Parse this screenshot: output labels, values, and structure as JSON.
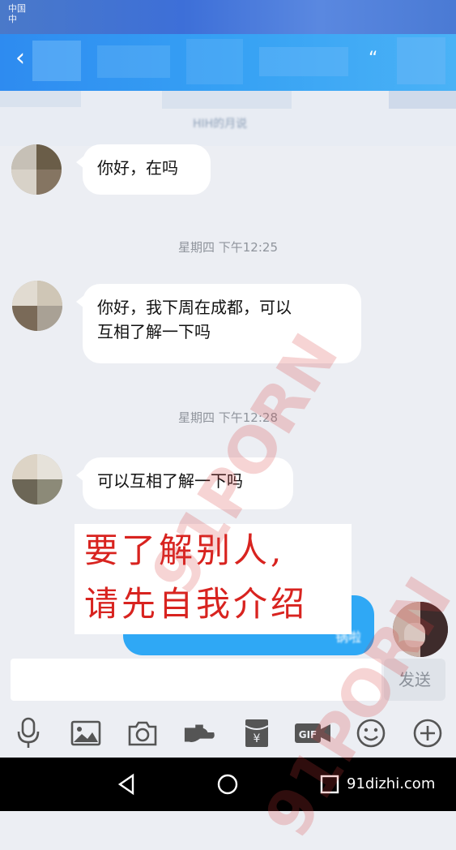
{
  "status_bar": {
    "carrier_line1": "中国",
    "carrier_line2": "中"
  },
  "header": {
    "back_icon": "back-arrow-icon",
    "subtitle_blurred": "HIH的月说"
  },
  "messages": [
    {
      "from": "other",
      "text": "你好，在吗"
    },
    {
      "type": "timestamp",
      "text": "星期四 下午12:25"
    },
    {
      "from": "other",
      "text_line1": "你好，我下周在成都，可以",
      "text_line2": "互相了解一下吗"
    },
    {
      "type": "timestamp",
      "text": "星期四 下午12:28"
    },
    {
      "from": "other",
      "text": "可以互相了解一下吗"
    },
    {
      "from": "me",
      "text_blurred": "锅啦"
    }
  ],
  "overlay_note": {
    "line1": "要了解别人,",
    "line2": "请先自我介绍"
  },
  "input": {
    "placeholder": "",
    "send_label": "发送"
  },
  "toolbar": [
    {
      "icon": "microphone-icon"
    },
    {
      "icon": "image-icon"
    },
    {
      "icon": "camera-icon"
    },
    {
      "icon": "red-packet-hand-icon"
    },
    {
      "icon": "gift-envelope-icon"
    },
    {
      "icon": "gif-icon",
      "label": "GIF"
    },
    {
      "icon": "emoji-icon"
    },
    {
      "icon": "plus-icon"
    }
  ],
  "watermark": {
    "site": "91dizhi.com",
    "text1": "91PORN",
    "text2": "91PORN"
  }
}
